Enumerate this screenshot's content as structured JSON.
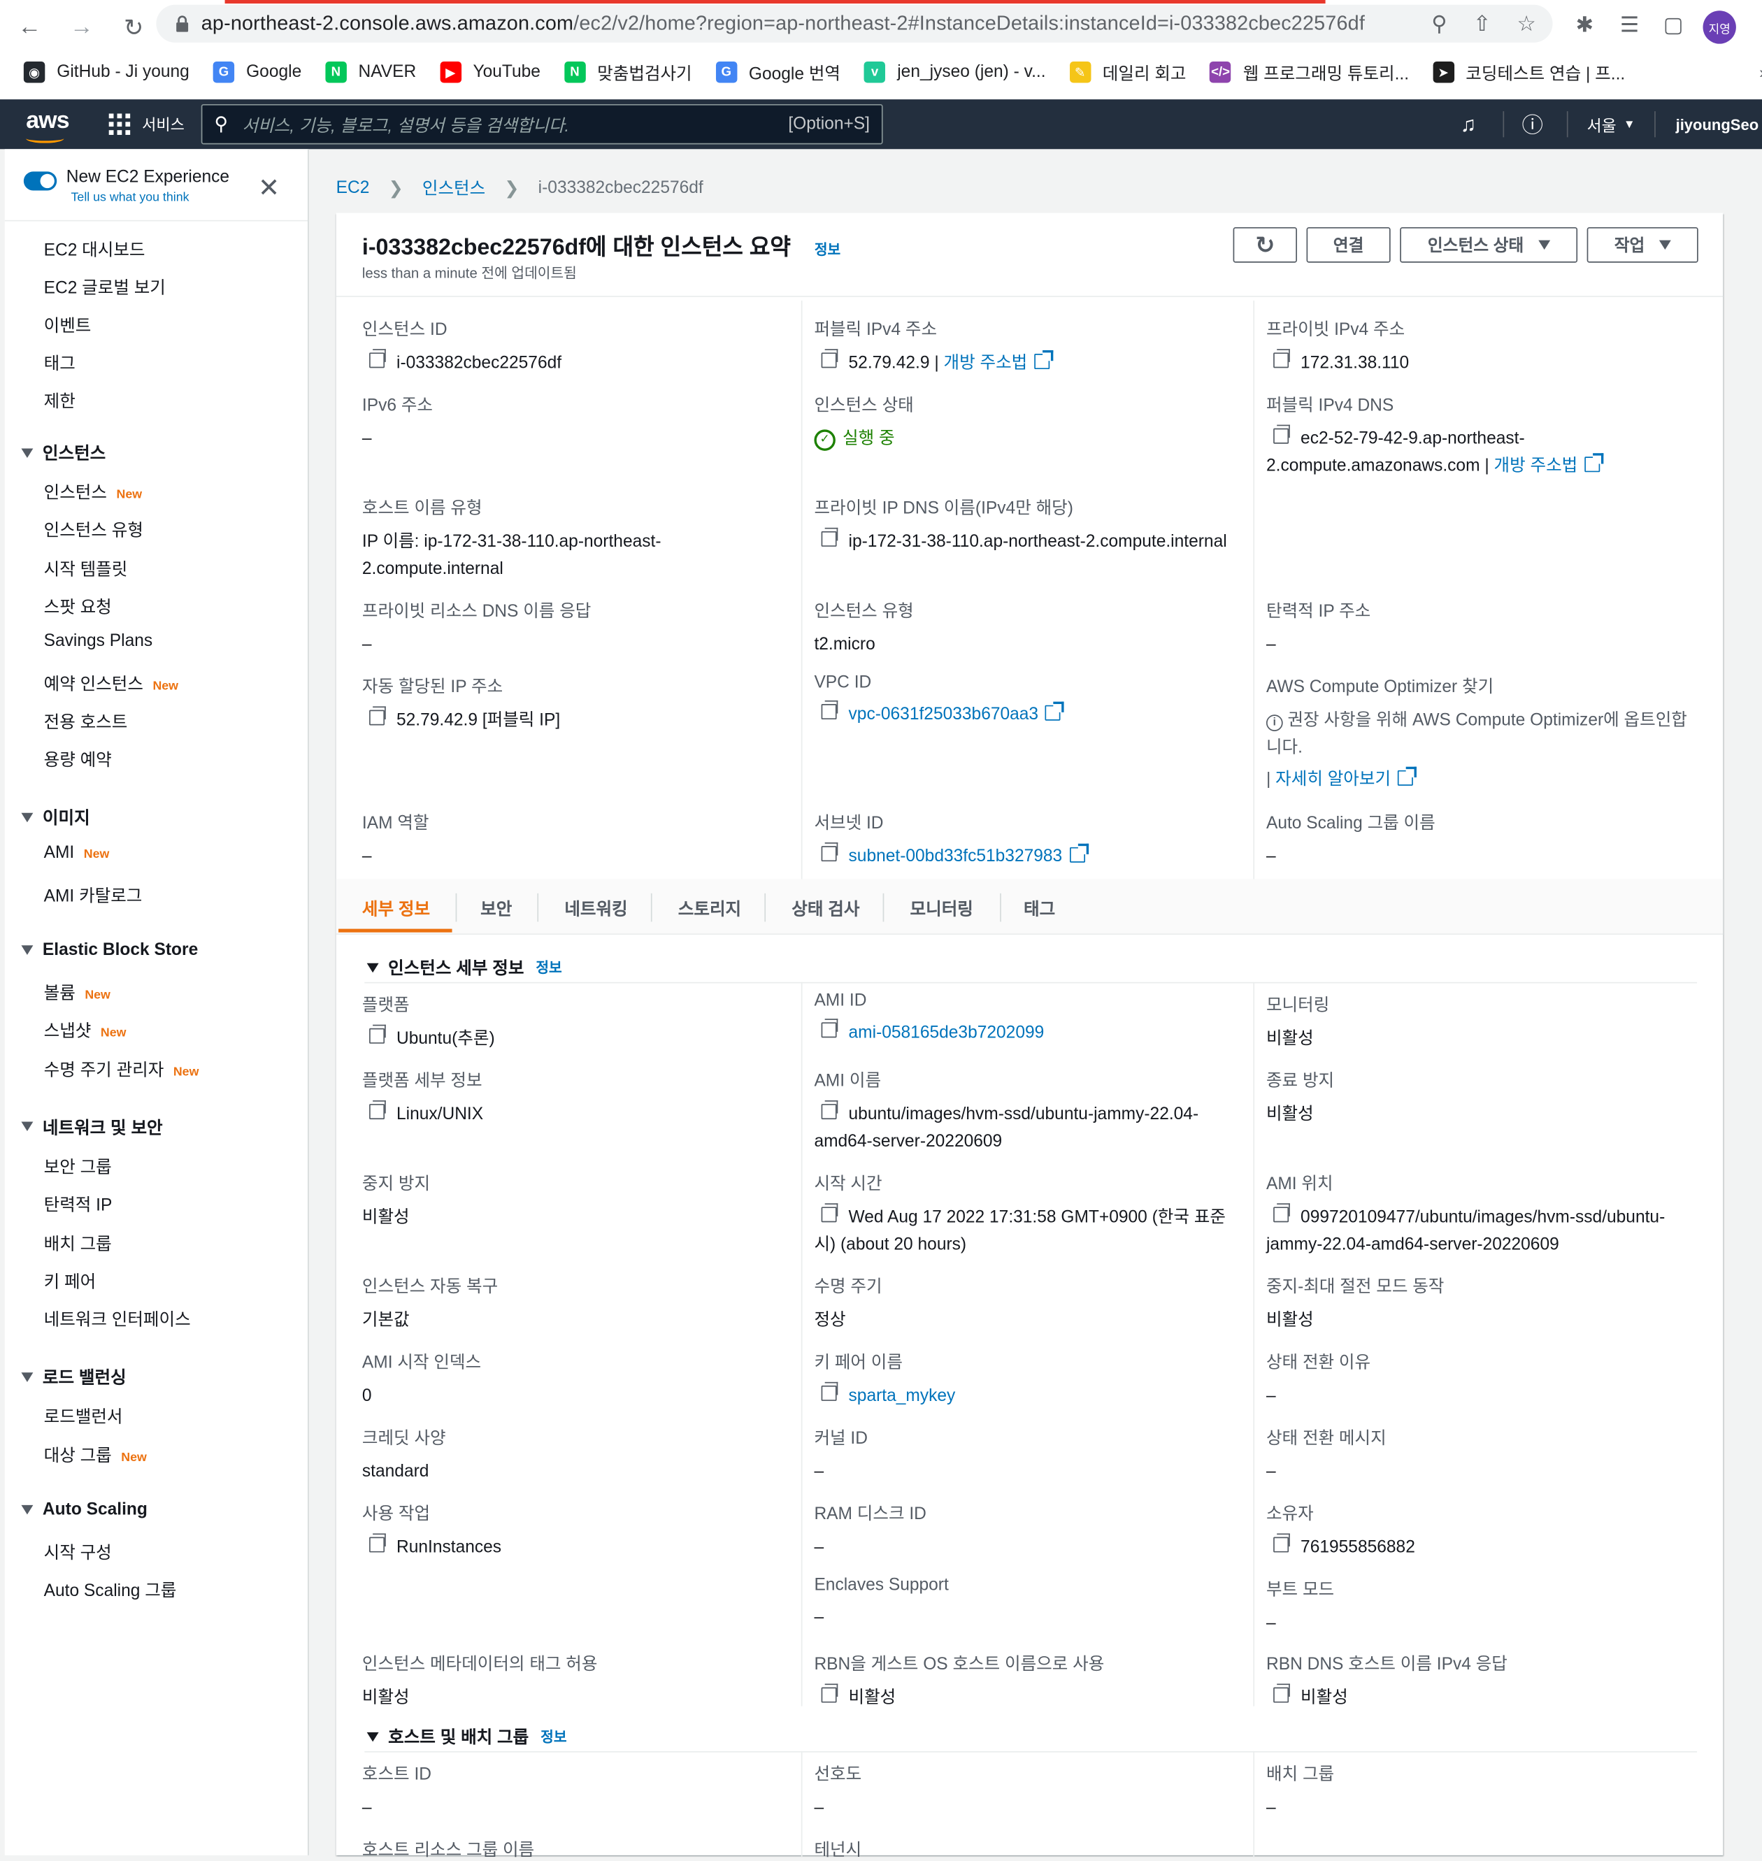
{
  "browser": {
    "url_host": "ap-northeast-2.console.aws.amazon.com",
    "url_rest": "/ec2/v2/home?region=ap-northeast-2#InstanceDetails:instanceId=i-033382cbec22576df",
    "profile_label": "지영",
    "bookmarks": [
      {
        "label": "GitHub - Ji young",
        "icon": "github-icon",
        "color": "#24292f"
      },
      {
        "label": "Google",
        "icon": "google-icon",
        "color": "#4285f4"
      },
      {
        "label": "NAVER",
        "icon": "naver-icon",
        "color": "#03c75a"
      },
      {
        "label": "YouTube",
        "icon": "youtube-icon",
        "color": "#ff0000"
      },
      {
        "label": "맞춤법검사기",
        "icon": "naver-icon",
        "color": "#03c75a"
      },
      {
        "label": "Google 번역",
        "icon": "translate-icon",
        "color": "#4285f4"
      },
      {
        "label": "jen_jyseo (jen) - v...",
        "icon": "velog-icon",
        "color": "#20c997"
      },
      {
        "label": "데일리 회고",
        "icon": "pencil-icon",
        "color": "#f5c518"
      },
      {
        "label": "웹 프로그래밍 튜토리...",
        "icon": "code-icon",
        "color": "#8e44ad"
      },
      {
        "label": "코딩테스트 연습 | 프...",
        "icon": "programmers-icon",
        "color": "#1e1e1e"
      }
    ]
  },
  "aws_nav": {
    "logo": "aws",
    "services": "서비스",
    "search_placeholder": "서비스, 기능, 블로그, 설명서 등을 검색합니다.",
    "search_hint": "[Option+S]",
    "region": "서울",
    "user": "jiyoungSeo"
  },
  "sidebar": {
    "experience_title": "New EC2 Experience",
    "experience_sub": "Tell us what you think",
    "new_badge": "New",
    "top_items": [
      "EC2 대시보드",
      "EC2 글로벌 보기",
      "이벤트",
      "태그",
      "제한"
    ],
    "groups": [
      {
        "title": "인스턴스",
        "items": [
          "인스턴스",
          "인스턴스 유형",
          "시작 템플릿",
          "스팟 요청",
          "Savings Plans",
          "예약 인스턴스",
          "전용 호스트",
          "용량 예약"
        ]
      },
      {
        "title": "이미지",
        "items": [
          "AMI",
          "AMI 카탈로그"
        ]
      },
      {
        "title": "Elastic Block Store",
        "items": [
          "볼륨",
          "스냅샷",
          "수명 주기 관리자"
        ]
      },
      {
        "title": "네트워크 및 보안",
        "items": [
          "보안 그룹",
          "탄력적 IP",
          "배치 그룹",
          "키 페어",
          "네트워크 인터페이스"
        ]
      },
      {
        "title": "로드 밸런싱",
        "items": [
          "로드밸런서",
          "대상 그룹"
        ]
      },
      {
        "title": "Auto Scaling",
        "items": [
          "시작 구성",
          "Auto Scaling 그룹"
        ]
      }
    ]
  },
  "breadcrumb": {
    "ec2": "EC2",
    "instances": "인스턴스",
    "current": "i-033382cbec22576df"
  },
  "summary": {
    "title": "i-033382cbec22576df에 대한 인스턴스 요약",
    "info": "정보",
    "updated": "less than a minute 전에 업데이트됨",
    "btn_connect": "연결",
    "btn_state": "인스턴스 상태",
    "btn_actions": "작업",
    "fields": {
      "instance_id_label": "인스턴스 ID",
      "instance_id": "i-033382cbec22576df",
      "public_ipv4_label": "퍼블릭 IPv4 주소",
      "public_ipv4": "52.79.42.9",
      "open_address": "개방 주소법",
      "private_ipv4_label": "프라이빗 IPv4 주소",
      "private_ipv4": "172.31.38.110",
      "ipv6_label": "IPv6 주소",
      "ipv6": "–",
      "state_label": "인스턴스 상태",
      "state": "실행 중",
      "public_dns_label": "퍼블릭 IPv4 DNS",
      "public_dns": "ec2-52-79-42-9.ap-northeast-2.compute.amazonaws.com",
      "hostname_type_label": "호스트 이름 유형",
      "hostname_type": "IP 이름: ip-172-31-38-110.ap-northeast-2.compute.internal",
      "private_dns_label": "프라이빗 IP DNS 이름(IPv4만 해당)",
      "private_dns": "ip-172-31-38-110.ap-northeast-2.compute.internal",
      "private_resource_dns_label": "프라이빗 리소스 DNS 이름 응답",
      "private_resource_dns": "–",
      "instance_type_label": "인스턴스 유형",
      "instance_type": "t2.micro",
      "elastic_ip_label": "탄력적 IP 주소",
      "elastic_ip": "–",
      "auto_ip_label": "자동 할당된 IP 주소",
      "auto_ip": "52.79.42.9 [퍼블릭 IP]",
      "vpc_label": "VPC ID",
      "vpc": "vpc-0631f25033b670aa3",
      "optimizer_label": "AWS Compute Optimizer 찾기",
      "optimizer_text": "권장 사항을 위해 AWS Compute Optimizer에 옵트인합니다.",
      "optimizer_link": "자세히 알아보기",
      "iam_label": "IAM 역할",
      "iam": "–",
      "subnet_label": "서브넷 ID",
      "subnet": "subnet-00bd33fc51b327983",
      "asg_label": "Auto Scaling 그룹 이름",
      "asg": "–"
    }
  },
  "tabs": [
    "세부 정보",
    "보안",
    "네트워킹",
    "스토리지",
    "상태 검사",
    "모니터링",
    "태그"
  ],
  "details": {
    "section_title": "인스턴스 세부 정보",
    "info": "정보",
    "platform_label": "플랫폼",
    "platform": "Ubuntu(추론)",
    "ami_id_label": "AMI ID",
    "ami_id": "ami-058165de3b7202099",
    "monitoring_label": "모니터링",
    "monitoring": "비활성",
    "platform_detail_label": "플랫폼 세부 정보",
    "platform_detail": "Linux/UNIX",
    "ami_name_label": "AMI 이름",
    "ami_name": "ubuntu/images/hvm-ssd/ubuntu-jammy-22.04-amd64-server-20220609",
    "termination_label": "종료 방지",
    "termination": "비활성",
    "stop_protect_label": "중지 방지",
    "stop_protect": "비활성",
    "launch_time_label": "시작 시간",
    "launch_time": "Wed Aug 17 2022 17:31:58 GMT+0900 (한국 표준시) (about 20 hours)",
    "ami_location_label": "AMI 위치",
    "ami_location": "099720109477/ubuntu/images/hvm-ssd/ubuntu-jammy-22.04-amd64-server-20220609",
    "auto_recovery_label": "인스턴스 자동 복구",
    "auto_recovery": "기본값",
    "lifecycle_label": "수명 주기",
    "lifecycle": "정상",
    "stop_hibernate_label": "중지-최대 절전 모드 동작",
    "stop_hibernate": "비활성",
    "ami_launch_index_label": "AMI 시작 인덱스",
    "ami_launch_index": "0",
    "key_pair_label": "키 페어 이름",
    "key_pair": "sparta_mykey",
    "state_reason_label": "상태 전환 이유",
    "state_reason": "–",
    "credit_label": "크레딧 사양",
    "credit": "standard",
    "kernel_label": "커널 ID",
    "kernel": "–",
    "state_message_label": "상태 전환 메시지",
    "state_message": "–",
    "usage_label": "사용 작업",
    "usage": "RunInstances",
    "ram_disk_label": "RAM 디스크 ID",
    "ram_disk": "–",
    "owner_label": "소유자",
    "owner": "761955856882",
    "enclaves_label": "Enclaves Support",
    "enclaves": "–",
    "boot_mode_label": "부트 모드",
    "boot_mode": "–",
    "meta_tags_label": "인스턴스 메타데이터의 태그 허용",
    "meta_tags": "비활성",
    "rbn_label": "RBN을 게스트 OS 호스트 이름으로 사용",
    "rbn": "비활성",
    "rbn_dns_label": "RBN DNS 호스트 이름 IPv4 응답",
    "rbn_dns": "비활성"
  },
  "host": {
    "section_title": "호스트 및 배치 그룹",
    "info": "정보",
    "host_id_label": "호스트 ID",
    "host_id": "–",
    "affinity_label": "선호도",
    "affinity": "–",
    "placement_label": "배치 그룹",
    "placement": "–",
    "host_resource_label": "호스트 리소스 그룹 이름",
    "tenancy_label": "테넌시"
  }
}
